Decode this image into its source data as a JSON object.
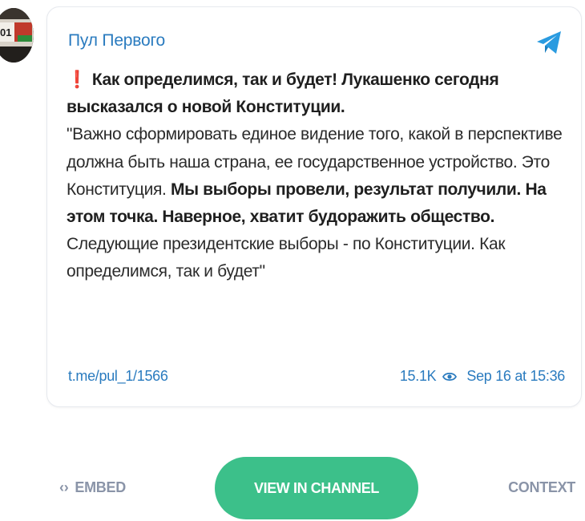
{
  "post": {
    "channel_name": "Пул Первого",
    "avatar_text": "01",
    "headline_mark": "❗",
    "paragraph": [
      {
        "text": "Как определимся, так и будет! Лукашенко сегодня высказался о новой Конституции.",
        "bold": true
      },
      {
        "text": "\n",
        "bold": false
      },
      {
        "text": "\"Важно сформировать единое видение того, какой в перспективе должна быть наша страна, ее государственное устройство. Это Конституция. ",
        "bold": false
      },
      {
        "text": "Мы выборы провели, результат получили. На этом точка. Наверное, хватит будоражить общество.",
        "bold": true
      },
      {
        "text": " Следующие президентские выборы - по Конституции. Как определимся, так и будет\"",
        "bold": false
      }
    ],
    "link": "t.me/pul_1/1566",
    "views": "15.1K",
    "date": "Sep 16 at 15:36"
  },
  "actions": {
    "embed_icon": "‹›",
    "embed_label": "EMBED",
    "view_label": "VIEW IN CHANNEL",
    "context_label": "CONTEXT"
  },
  "colors": {
    "link_blue": "#2a7bbf",
    "button_green": "#3cc08a",
    "muted_gray": "#8a94a8",
    "alert_red": "#e0262b"
  },
  "icons": {
    "telegram": "telegram-plane-icon",
    "views": "eye-icon",
    "embed": "code-brackets-icon"
  }
}
